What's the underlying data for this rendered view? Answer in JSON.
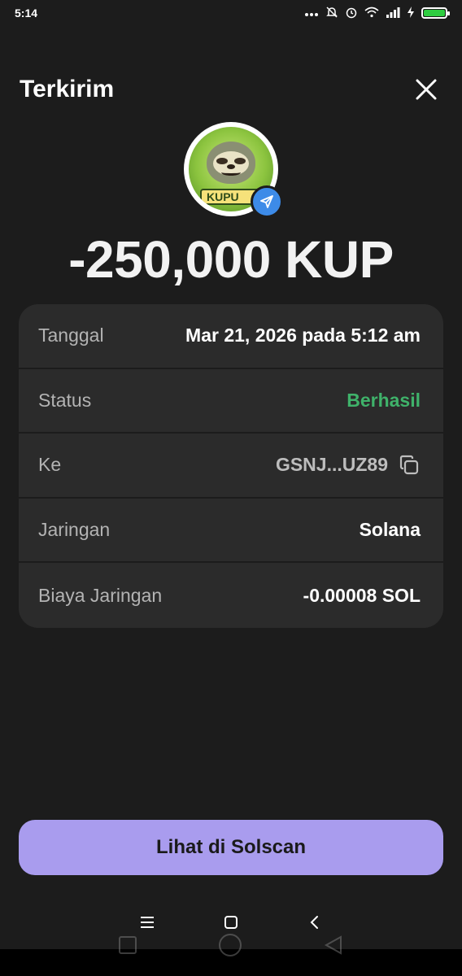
{
  "status_bar": {
    "time": "5:14",
    "icons": [
      "more-dots-icon",
      "bell-off-icon",
      "alarm-icon",
      "wifi-icon",
      "signal-icon",
      "charging-icon",
      "battery-icon"
    ]
  },
  "header": {
    "title": "Terkirim",
    "close_icon": "close-icon"
  },
  "token": {
    "logo_text": "KUPU",
    "badge_icon": "send-icon",
    "amount": "-250,000 KUP"
  },
  "details": [
    {
      "label": "Tanggal",
      "value": "Mar 21, 2026 pada 5:12 am"
    },
    {
      "label": "Status",
      "value": "Berhasil"
    },
    {
      "label": "Ke",
      "value": "GSNJ...UZ89"
    },
    {
      "label": "Jaringan",
      "value": "Solana"
    },
    {
      "label": "Biaya Jaringan",
      "value": "-0.00008 SOL"
    }
  ],
  "colors": {
    "background": "#1c1c1c",
    "card": "#2b2b2b",
    "success": "#3fb26a",
    "primary_button": "#a99cee",
    "badge": "#3d8be8"
  },
  "primary_action": {
    "label": "Lihat di Solscan"
  },
  "nav": {
    "items": [
      "menu-icon",
      "home-icon",
      "back-icon"
    ]
  }
}
